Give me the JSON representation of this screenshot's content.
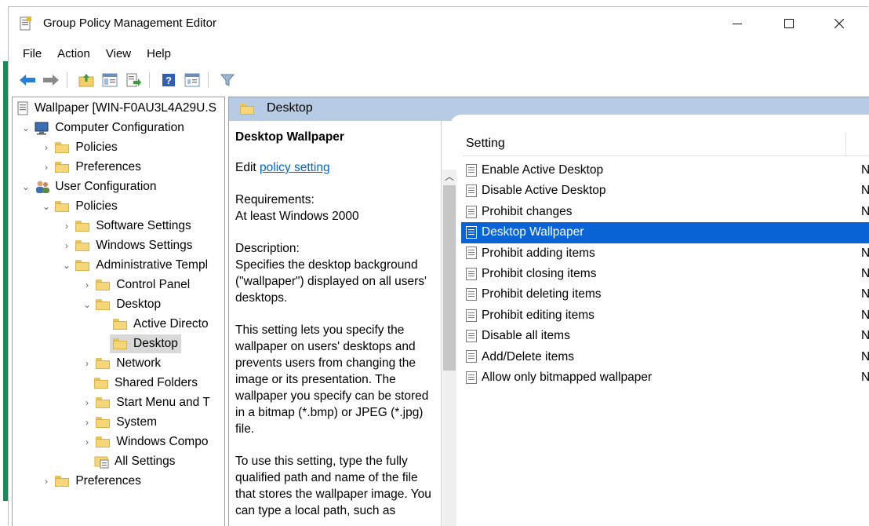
{
  "window": {
    "title": "Group Policy Management Editor"
  },
  "menu": [
    "File",
    "Action",
    "View",
    "Help"
  ],
  "toolbar": [
    "back-icon",
    "forward-icon",
    "up-folder-icon",
    "show-hide-tree-icon",
    "export-list-icon",
    "help-icon",
    "properties-icon",
    "filter-icon"
  ],
  "tree": {
    "root": "Wallpaper [WIN-F0AU3L4A29U.S",
    "computer_configuration": "Computer Configuration",
    "cc_policies": "Policies",
    "cc_preferences": "Preferences",
    "user_configuration": "User Configuration",
    "uc_policies": "Policies",
    "software_settings": "Software Settings",
    "windows_settings": "Windows Settings",
    "administrative_templates": "Administrative Templ",
    "control_panel": "Control Panel",
    "desktop": "Desktop",
    "active_directory": "Active Directo",
    "desktop_child": "Desktop",
    "network": "Network",
    "shared_folders": "Shared Folders",
    "start_menu": "Start Menu and T",
    "system": "System",
    "windows_components": "Windows Compo",
    "all_settings": "All Settings",
    "uc_preferences": "Preferences"
  },
  "banner": {
    "title": "Desktop"
  },
  "description": {
    "heading": "Desktop Wallpaper",
    "edit_prefix": "Edit ",
    "edit_link": "policy setting ",
    "requirements_label": "Requirements:",
    "requirements_value": "At least Windows 2000",
    "description_label": "Description:",
    "description_text": "Specifies the desktop background (\"wallpaper\") displayed on all users' desktops.",
    "para2": "This setting lets you specify the wallpaper on users' desktops and prevents users from changing the image or its presentation. The wallpaper you specify can be stored in a bitmap (*.bmp) or JPEG (*.jpg) file.",
    "para3": "To use this setting, type the fully qualified path and name of the file that stores the wallpaper image. You can type a local path, such as"
  },
  "list": {
    "header": "Setting",
    "rows": [
      {
        "name": "Enable Active Desktop",
        "state": "No"
      },
      {
        "name": "Disable Active Desktop",
        "state": "No"
      },
      {
        "name": "Prohibit changes",
        "state": "No"
      },
      {
        "name": "Desktop Wallpaper",
        "state": "",
        "selected": true
      },
      {
        "name": "Prohibit adding items",
        "state": "No"
      },
      {
        "name": "Prohibit closing items",
        "state": "No"
      },
      {
        "name": "Prohibit deleting items",
        "state": "No"
      },
      {
        "name": "Prohibit editing items",
        "state": "No"
      },
      {
        "name": "Disable all items",
        "state": "No"
      },
      {
        "name": "Add/Delete items",
        "state": "No"
      },
      {
        "name": "Allow only bitmapped wallpaper",
        "state": "No"
      }
    ]
  }
}
